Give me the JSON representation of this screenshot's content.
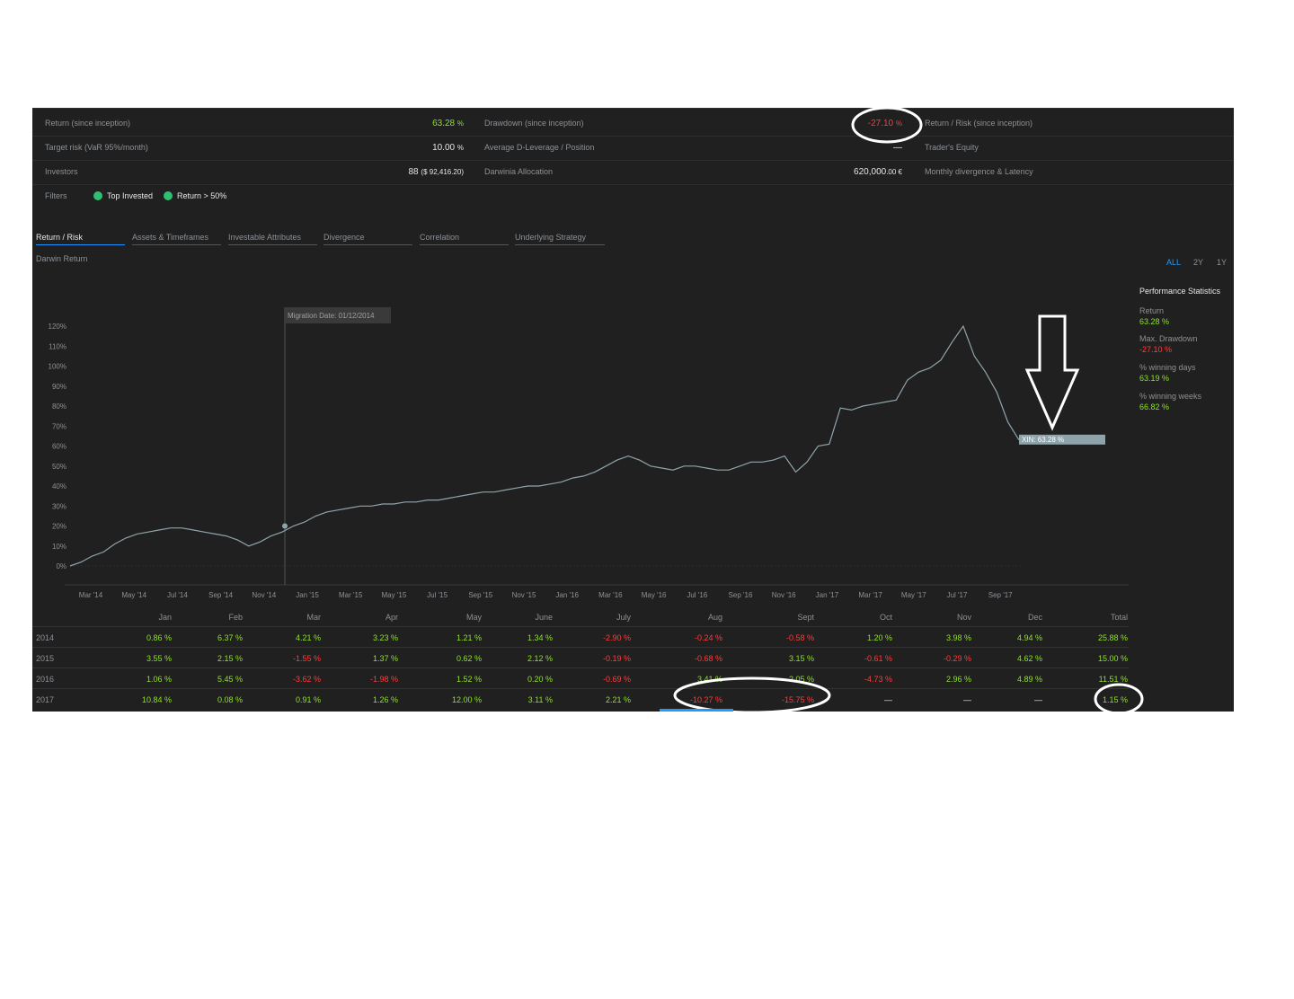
{
  "header_rows": [
    {
      "label": "Return (since inception)",
      "value": "63.28",
      "unit": "%",
      "status": "positive",
      "label2": "Drawdown (since inception)",
      "value2": "-27.10",
      "unit2": "%",
      "status2": "negative",
      "label3": "Return / Risk (since inception)"
    },
    {
      "label": "Target risk (VaR 95%/month)",
      "value": "10.00",
      "unit": "%",
      "status": "neutral",
      "label2": "Average D-Leverage / Position",
      "value2": "—",
      "unit2": "",
      "status2": "neutral",
      "label3": "Trader's Equity"
    },
    {
      "label": "Investors",
      "value": "88",
      "unit": "($ 92,416.20)",
      "status": "neutral",
      "label2": "Darwinia Allocation",
      "value2": "620,000",
      "unit2": ".00 €",
      "status2": "neutral",
      "label3": "Monthly divergence & Latency"
    }
  ],
  "filters": {
    "label": "Filters",
    "chips": [
      "Top Invested",
      "Return > 50%"
    ]
  },
  "tabs": [
    "Return / Risk",
    "Assets & Timeframes",
    "Investable Attributes",
    "Divergence",
    "Correlation",
    "Underlying Strategy"
  ],
  "active_tab": "Return / Risk",
  "chart_title": "Darwin Return",
  "ranges": [
    "ALL",
    "2Y",
    "1Y"
  ],
  "active_range": "ALL",
  "migration_label": "Migration Date: 01/12/2014",
  "end_label": "XIN: 63.28 %",
  "performance": {
    "title": "Performance Statistics",
    "items": [
      {
        "label": "Return",
        "value": "63.28 %",
        "status": "positive"
      },
      {
        "label": "Max. Drawdown",
        "value": "-27.10 %",
        "status": "negative"
      },
      {
        "label": "% winning days",
        "value": "63.19 %",
        "status": "positive"
      },
      {
        "label": "% winning weeks",
        "value": "66.82 %",
        "status": "positive"
      }
    ]
  },
  "monthly_table": {
    "headers": [
      "Jan",
      "Feb",
      "Mar",
      "Apr",
      "May",
      "June",
      "July",
      "Aug",
      "Sept",
      "Oct",
      "Nov",
      "Dec",
      "Total"
    ],
    "rows": [
      {
        "year": "2014",
        "values": [
          "0.86 %",
          "6.37 %",
          "4.21 %",
          "3.23 %",
          "1.21 %",
          "1.34 %",
          "-2.90 %",
          "-0.24 %",
          "-0.58 %",
          "1.20 %",
          "3.98 %",
          "4.94 %",
          "25.88 %"
        ]
      },
      {
        "year": "2015",
        "values": [
          "3.55 %",
          "2.15 %",
          "-1.55 %",
          "1.37 %",
          "0.62 %",
          "2.12 %",
          "-0.19 %",
          "-0.68 %",
          "3.15 %",
          "-0.61 %",
          "-0.29 %",
          "4.62 %",
          "15.00 %"
        ]
      },
      {
        "year": "2016",
        "values": [
          "1.06 %",
          "5.45 %",
          "-3.62 %",
          "-1.98 %",
          "1.52 %",
          "0.20 %",
          "-0.69 %",
          "3.41 %",
          "2.05 %",
          "-4.73 %",
          "2.96 %",
          "4.89 %",
          "11.51 %"
        ]
      },
      {
        "year": "2017",
        "values": [
          "10.84 %",
          "0.08 %",
          "0.91 %",
          "1.26 %",
          "12.00 %",
          "3.11 %",
          "2.21 %",
          "-10.27 %",
          "-15.75 %",
          "—",
          "—",
          "—",
          "1.15 %"
        ]
      }
    ]
  },
  "chart_data": {
    "type": "line",
    "title": "Darwin Return",
    "xlabel": "",
    "ylabel": "",
    "x_ticks": [
      "Mar '14",
      "May '14",
      "Jul '14",
      "Sep '14",
      "Nov '14",
      "Jan '15",
      "Mar '15",
      "May '15",
      "Jul '15",
      "Sep '15",
      "Nov '15",
      "Jan '16",
      "Mar '16",
      "May '16",
      "Jul '16",
      "Sep '16",
      "Nov '16",
      "Jan '17",
      "Mar '17",
      "May '17",
      "Jul '17",
      "Sep '17"
    ],
    "y_ticks": [
      "0%",
      "10%",
      "20%",
      "30%",
      "40%",
      "50%",
      "60%",
      "70%",
      "80%",
      "90%",
      "100%",
      "110%",
      "120%"
    ],
    "ylim": [
      0,
      120
    ],
    "series": [
      {
        "values": [
          0,
          2,
          5,
          7,
          11,
          14,
          16,
          17,
          18,
          19,
          19,
          18,
          17,
          16,
          15,
          13,
          10,
          12,
          15,
          17,
          20,
          22,
          25,
          27,
          28,
          29,
          30,
          30,
          31,
          31,
          32,
          32,
          33,
          33,
          34,
          35,
          36,
          37,
          37,
          38,
          39,
          40,
          40,
          41,
          42,
          44,
          45,
          47,
          50,
          53,
          55,
          53,
          50,
          49,
          48,
          50,
          50,
          49,
          48,
          48,
          50,
          52,
          52,
          53,
          55,
          47,
          52,
          60,
          61,
          79,
          78,
          80,
          81,
          82,
          83,
          93,
          97,
          99,
          103,
          112,
          120,
          105,
          97,
          87,
          72,
          63
        ]
      }
    ],
    "annotations": [
      "Migration Date: 01/12/2014",
      "XIN: 63.28 %"
    ],
    "grid": false
  },
  "colors": {
    "panel": "#202020",
    "positive": "#8ee02a",
    "negative": "#ff3b3b",
    "line": "#8fa4aa",
    "accent": "#1e9bff"
  }
}
